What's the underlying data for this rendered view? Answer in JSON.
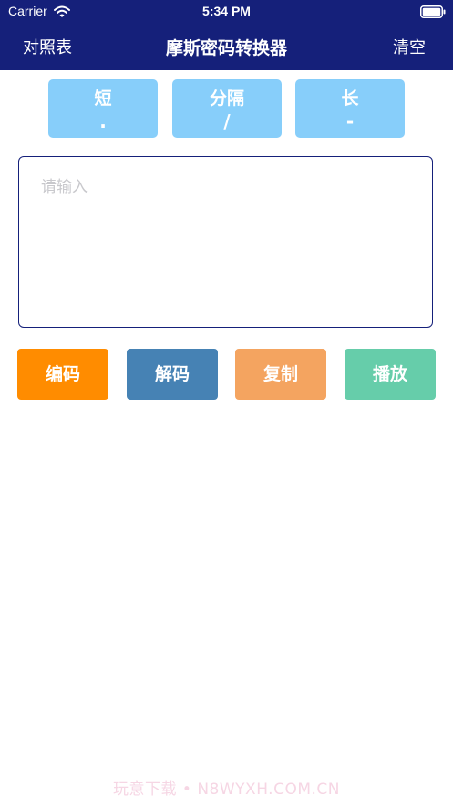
{
  "status_bar": {
    "carrier": "Carrier",
    "time": "5:34 PM",
    "wifi_icon": "wifi-icon",
    "battery_icon": "battery-icon"
  },
  "nav": {
    "left_label": "对照表",
    "title": "摩斯密码转换器",
    "right_label": "清空",
    "background": "#15207a"
  },
  "symbols": {
    "color": "#87cefa",
    "short": {
      "label": "短",
      "mark": "."
    },
    "separator": {
      "label": "分隔",
      "mark": "/"
    },
    "long": {
      "label": "长",
      "mark": "-"
    }
  },
  "input": {
    "placeholder": "请输入",
    "value": ""
  },
  "actions": {
    "encode": {
      "label": "编码",
      "color": "#ff8c00"
    },
    "decode": {
      "label": "解码",
      "color": "#4682b4"
    },
    "copy": {
      "label": "复制",
      "color": "#f4a460"
    },
    "play": {
      "label": "播放",
      "color": "#66cdaa"
    }
  },
  "watermark": "玩意下载 • N8WYXH.COM.CN"
}
